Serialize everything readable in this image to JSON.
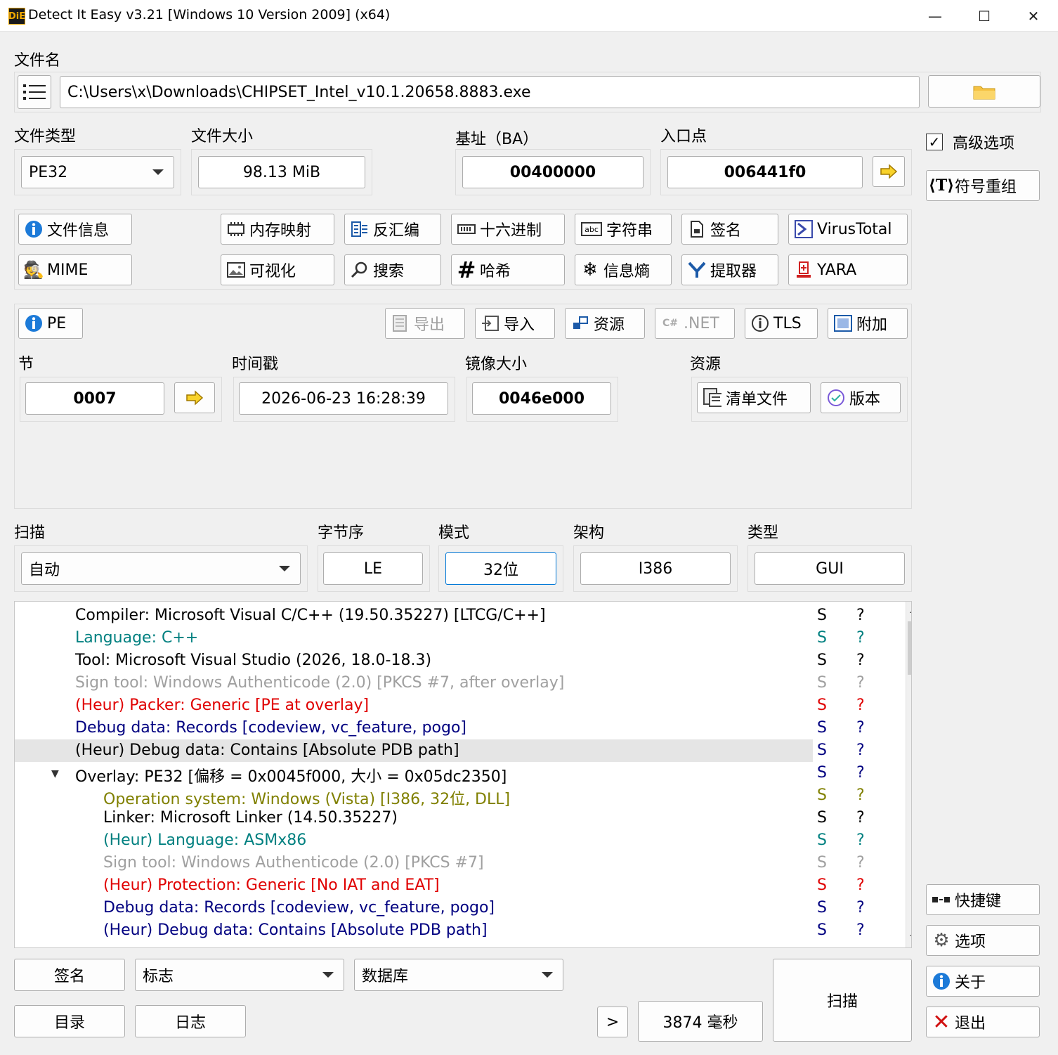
{
  "window": {
    "title": "Detect It Easy v3.21 [Windows 10 Version 2009] (x64)",
    "logo_text": "DiE",
    "controls": {
      "minimize": "—",
      "maximize": "☐",
      "close": "✕"
    }
  },
  "file": {
    "label": "文件名",
    "path": "C:\\Users\\x\\Downloads\\CHIPSET_Intel_v10.1.20658.8883.exe"
  },
  "info": {
    "file_type_label": "文件类型",
    "file_type_value": "PE32",
    "file_size_label": "文件大小",
    "file_size_value": "98.13 MiB",
    "base_label": "基址（BA）",
    "base_value": "00400000",
    "entry_label": "入口点",
    "entry_value": "006441f0"
  },
  "side": {
    "advanced_label": "高级选项",
    "advanced_checked": true,
    "rebuild_label": "符号重组",
    "shortcuts_label": "快捷键",
    "options_label": "选项",
    "about_label": "关于",
    "exit_label": "退出"
  },
  "tools": {
    "file_info": "文件信息",
    "memory_map": "内存映射",
    "disasm": "反汇编",
    "hex": "十六进制",
    "strings": "字符串",
    "signatures": "签名",
    "virustotal": "VirusTotal",
    "mime": "MIME",
    "visualize": "可视化",
    "search": "搜索",
    "hash": "哈希",
    "entropy": "信息熵",
    "extractor": "提取器",
    "yara": "YARA"
  },
  "pe": {
    "pe_button": "PE",
    "export": "导出",
    "import": "导入",
    "resources": "资源",
    "net": ".NET",
    "tls": "TLS",
    "overlay": "附加",
    "sections_label": "节",
    "sections_value": "0007",
    "timestamp_label": "时间戳",
    "timestamp_value": "2026-06-23 16:28:39",
    "image_size_label": "镜像大小",
    "image_size_value": "0046e000",
    "res_label": "资源",
    "manifest": "清单文件",
    "version": "版本"
  },
  "scan": {
    "scan_label": "扫描",
    "scan_mode": "自动",
    "endian_label": "字节序",
    "endian_value": "LE",
    "mode_label": "模式",
    "mode_value": "32位",
    "arch_label": "架构",
    "arch_value": "I386",
    "type_label": "类型",
    "type_value": "GUI"
  },
  "results": [
    {
      "text": "Compiler: Microsoft Visual C/C++ (19.50.35227) [LTCG/C++]",
      "color": "#000000",
      "indent": 0
    },
    {
      "text": "Language: C++",
      "color": "#008080",
      "indent": 0
    },
    {
      "text": "Tool: Microsoft Visual Studio (2026, 18.0-18.3)",
      "color": "#000000",
      "indent": 0
    },
    {
      "text": "Sign tool: Windows Authenticode (2.0) [PKCS #7, after overlay]",
      "color": "#a0a0a0",
      "indent": 0
    },
    {
      "text": "(Heur) Packer: Generic [PE at overlay]",
      "color": "#e00000",
      "indent": 0
    },
    {
      "text": "Debug data: Records [codeview, vc_feature, pogo]",
      "color": "#000080",
      "indent": 0
    },
    {
      "text": "(Heur) Debug data: Contains [Absolute PDB path]",
      "color": "#000000",
      "indent": 0,
      "selected": true,
      "flag_color": "#000080"
    },
    {
      "text": "Overlay: PE32 [偏移 = 0x0045f000, 大小 = 0x05dc2350]",
      "color": "#000000",
      "indent": 0,
      "expander": true,
      "flag_color": "#000080"
    },
    {
      "text": "Operation system: Windows (Vista) [I386, 32位, DLL]",
      "color": "#808000",
      "indent": 1
    },
    {
      "text": "Linker: Microsoft Linker (14.50.35227)",
      "color": "#000000",
      "indent": 1
    },
    {
      "text": "(Heur) Language: ASMx86",
      "color": "#008080",
      "indent": 1
    },
    {
      "text": "Sign tool: Windows Authenticode (2.0) [PKCS #7]",
      "color": "#a0a0a0",
      "indent": 1
    },
    {
      "text": "(Heur) Protection: Generic [No IAT and EAT]",
      "color": "#e00000",
      "indent": 1
    },
    {
      "text": "Debug data: Records [codeview, vc_feature, pogo]",
      "color": "#000080",
      "indent": 1
    },
    {
      "text": "(Heur) Debug data: Contains [Absolute PDB path]",
      "color": "#000080",
      "indent": 1
    }
  ],
  "result_flags": {
    "s": "S",
    "q": "?"
  },
  "expander_glyph": "▼",
  "bottom": {
    "signatures": "签名",
    "flags": "标志",
    "database": "数据库",
    "scan": "扫描",
    "directory": "目录",
    "log": "日志",
    "more": ">",
    "elapsed": "3874 毫秒"
  }
}
